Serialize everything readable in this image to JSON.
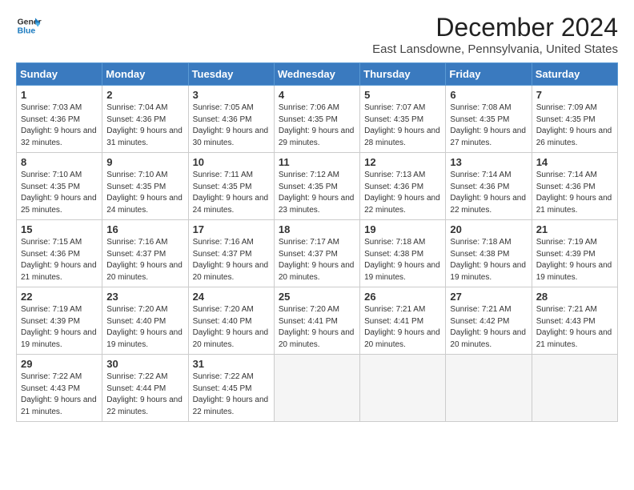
{
  "logo": {
    "line1": "General",
    "line2": "Blue"
  },
  "title": "December 2024",
  "subtitle": "East Lansdowne, Pennsylvania, United States",
  "days_of_week": [
    "Sunday",
    "Monday",
    "Tuesday",
    "Wednesday",
    "Thursday",
    "Friday",
    "Saturday"
  ],
  "weeks": [
    [
      {
        "day": 1,
        "rise": "7:03 AM",
        "set": "4:36 PM",
        "daylight": "9 hours and 32 minutes."
      },
      {
        "day": 2,
        "rise": "7:04 AM",
        "set": "4:36 PM",
        "daylight": "9 hours and 31 minutes."
      },
      {
        "day": 3,
        "rise": "7:05 AM",
        "set": "4:36 PM",
        "daylight": "9 hours and 30 minutes."
      },
      {
        "day": 4,
        "rise": "7:06 AM",
        "set": "4:35 PM",
        "daylight": "9 hours and 29 minutes."
      },
      {
        "day": 5,
        "rise": "7:07 AM",
        "set": "4:35 PM",
        "daylight": "9 hours and 28 minutes."
      },
      {
        "day": 6,
        "rise": "7:08 AM",
        "set": "4:35 PM",
        "daylight": "9 hours and 27 minutes."
      },
      {
        "day": 7,
        "rise": "7:09 AM",
        "set": "4:35 PM",
        "daylight": "9 hours and 26 minutes."
      }
    ],
    [
      {
        "day": 8,
        "rise": "7:10 AM",
        "set": "4:35 PM",
        "daylight": "9 hours and 25 minutes."
      },
      {
        "day": 9,
        "rise": "7:10 AM",
        "set": "4:35 PM",
        "daylight": "9 hours and 24 minutes."
      },
      {
        "day": 10,
        "rise": "7:11 AM",
        "set": "4:35 PM",
        "daylight": "9 hours and 24 minutes."
      },
      {
        "day": 11,
        "rise": "7:12 AM",
        "set": "4:35 PM",
        "daylight": "9 hours and 23 minutes."
      },
      {
        "day": 12,
        "rise": "7:13 AM",
        "set": "4:36 PM",
        "daylight": "9 hours and 22 minutes."
      },
      {
        "day": 13,
        "rise": "7:14 AM",
        "set": "4:36 PM",
        "daylight": "9 hours and 22 minutes."
      },
      {
        "day": 14,
        "rise": "7:14 AM",
        "set": "4:36 PM",
        "daylight": "9 hours and 21 minutes."
      }
    ],
    [
      {
        "day": 15,
        "rise": "7:15 AM",
        "set": "4:36 PM",
        "daylight": "9 hours and 21 minutes."
      },
      {
        "day": 16,
        "rise": "7:16 AM",
        "set": "4:37 PM",
        "daylight": "9 hours and 20 minutes."
      },
      {
        "day": 17,
        "rise": "7:16 AM",
        "set": "4:37 PM",
        "daylight": "9 hours and 20 minutes."
      },
      {
        "day": 18,
        "rise": "7:17 AM",
        "set": "4:37 PM",
        "daylight": "9 hours and 20 minutes."
      },
      {
        "day": 19,
        "rise": "7:18 AM",
        "set": "4:38 PM",
        "daylight": "9 hours and 19 minutes."
      },
      {
        "day": 20,
        "rise": "7:18 AM",
        "set": "4:38 PM",
        "daylight": "9 hours and 19 minutes."
      },
      {
        "day": 21,
        "rise": "7:19 AM",
        "set": "4:39 PM",
        "daylight": "9 hours and 19 minutes."
      }
    ],
    [
      {
        "day": 22,
        "rise": "7:19 AM",
        "set": "4:39 PM",
        "daylight": "9 hours and 19 minutes."
      },
      {
        "day": 23,
        "rise": "7:20 AM",
        "set": "4:40 PM",
        "daylight": "9 hours and 19 minutes."
      },
      {
        "day": 24,
        "rise": "7:20 AM",
        "set": "4:40 PM",
        "daylight": "9 hours and 20 minutes."
      },
      {
        "day": 25,
        "rise": "7:20 AM",
        "set": "4:41 PM",
        "daylight": "9 hours and 20 minutes."
      },
      {
        "day": 26,
        "rise": "7:21 AM",
        "set": "4:41 PM",
        "daylight": "9 hours and 20 minutes."
      },
      {
        "day": 27,
        "rise": "7:21 AM",
        "set": "4:42 PM",
        "daylight": "9 hours and 20 minutes."
      },
      {
        "day": 28,
        "rise": "7:21 AM",
        "set": "4:43 PM",
        "daylight": "9 hours and 21 minutes."
      }
    ],
    [
      {
        "day": 29,
        "rise": "7:22 AM",
        "set": "4:43 PM",
        "daylight": "9 hours and 21 minutes."
      },
      {
        "day": 30,
        "rise": "7:22 AM",
        "set": "4:44 PM",
        "daylight": "9 hours and 22 minutes."
      },
      {
        "day": 31,
        "rise": "7:22 AM",
        "set": "4:45 PM",
        "daylight": "9 hours and 22 minutes."
      },
      null,
      null,
      null,
      null
    ]
  ],
  "labels": {
    "sunrise": "Sunrise:",
    "sunset": "Sunset:",
    "daylight": "Daylight:"
  }
}
